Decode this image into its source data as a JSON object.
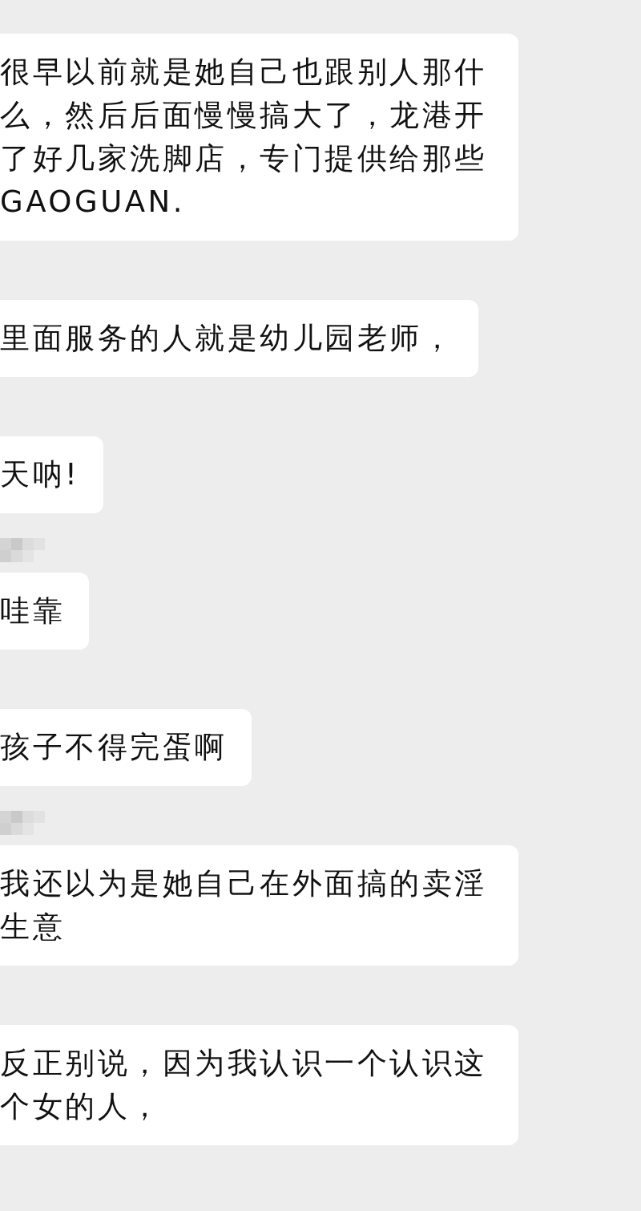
{
  "messages": [
    {
      "text": "很早以前就是她自己也跟别人那什么，然后后面慢慢搞大了，龙港开了好几家洗脚店，专门提供给那些GAOGUAN.",
      "name_blurred": false
    },
    {
      "text": "里面服务的人就是幼儿园老师，",
      "name_blurred": false
    },
    {
      "text": "天呐!",
      "name_blurred": false
    },
    {
      "text": "哇靠",
      "name_blurred": true
    },
    {
      "text": "孩子不得完蛋啊",
      "name_blurred": false
    },
    {
      "text": "我还以为是她自己在外面搞的卖淫生意",
      "name_blurred": true
    },
    {
      "text": "反正别说，因为我认识一个认识这个女的人，",
      "name_blurred": false
    }
  ]
}
